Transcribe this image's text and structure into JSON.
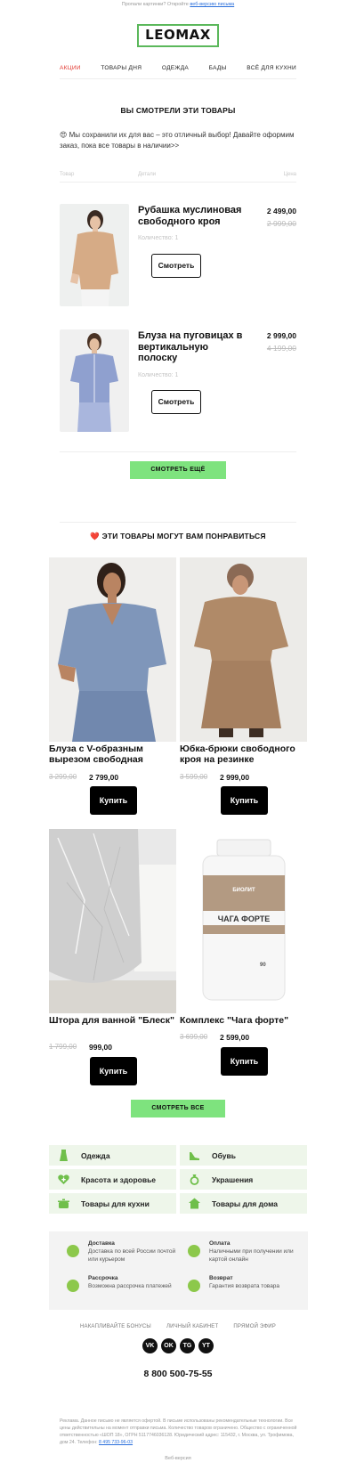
{
  "preheader": {
    "text": "Пропали картинки? Откройте ",
    "link": "веб-версию письма"
  },
  "logo": "LEOMAX",
  "nav": [
    "АКЦИИ",
    "ТОВАРЫ ДНЯ",
    "ОДЕЖДА",
    "БАДЫ",
    "ВСЁ ДЛЯ КУХНИ"
  ],
  "viewed": {
    "title": "ВЫ СМОТРЕЛИ ЭТИ ТОВАРЫ",
    "intro": "😍 Мы сохранили их для вас – это отличный выбор! Давайте оформим заказ, пока все товары в наличии>>",
    "columns": {
      "item": "Товар",
      "details": "Детали",
      "price": "Цена"
    },
    "items": [
      {
        "name": "Рубашка муслиновая свободного кроя",
        "qty": "Количество: 1",
        "price": "2 499,00",
        "old_price": "2 999,00",
        "button": "Смотреть"
      },
      {
        "name": "Блуза на пуговицах в вертикальную полоску",
        "qty": "Количество: 1",
        "price": "2 999,00",
        "old_price": "4 199,00",
        "button": "Смотреть"
      }
    ],
    "more_button": "СМОТРЕТЬ ЕЩЁ"
  },
  "recommend": {
    "title": "❤️ ЭТИ ТОВАРЫ МОГУТ ВАМ ПОНРАВИТЬСЯ",
    "items": [
      {
        "name": "Блуза с V-образным вырезом свободная",
        "old_price": "3 299,00",
        "price": "2 799,00",
        "button": "Купить"
      },
      {
        "name": "Юбка-брюки свободного кроя на резинке",
        "old_price": "3 599,00",
        "price": "2 999,00",
        "button": "Купить"
      },
      {
        "name": "Штора для ванной \"Блеск\"",
        "old_price": "1 799,00",
        "price": "999,00",
        "button": "Купить"
      },
      {
        "name": "Комплекс \"Чага форте\"",
        "old_price": "3 699,00",
        "price": "2 599,00",
        "button": "Купить"
      }
    ],
    "all_button": "СМОТРЕТЬ ВСЕ"
  },
  "jar_label": {
    "brand": "БИОЛИТ",
    "product": "ЧАГА ФОРТЕ",
    "count": "90"
  },
  "categories": [
    "Одежда",
    "Обувь",
    "Красота и здоровье",
    "Украшения",
    "Товары для кухни",
    "Товары для дома"
  ],
  "info": [
    {
      "title": "Доставка",
      "text": "Доставка по всей России почтой или курьером"
    },
    {
      "title": "Оплата",
      "text": "Наличными при получении или картой онлайн"
    },
    {
      "title": "Рассрочка",
      "text": "Возможна рассрочка платежей"
    },
    {
      "title": "Возврат",
      "text": "Гарантия возврата товара"
    }
  ],
  "footer_links": [
    "НАКАПЛИВАЙТЕ БОНУСЫ",
    "ЛИЧНЫЙ КАБИНЕТ",
    "ПРЯМОЙ ЭФИР"
  ],
  "socials": [
    "VK",
    "OK",
    "TG",
    "YT"
  ],
  "phone": "8 800 500-75-55",
  "legal": {
    "text": "Реклама. Данное письмо не является офертой. В письме использованы рекомендательные технологии. Все цены действительны на момент отправки письма. Количество товаров ограничено. Общество с ограниченной ответственностью «ШОП 18», ОГРН 5117746036128. Юридический адрес: 115432, г. Москва, ул. Трофимова, дом 24. Телефон: ",
    "phone_link": "8 495 733-96-03"
  },
  "web_version": "Веб-версия",
  "colors": {
    "accent_green": "#7ee37e",
    "logo_border": "#5bb85b",
    "nav_active": "#e23a32",
    "category_bg": "#eef6ea"
  }
}
